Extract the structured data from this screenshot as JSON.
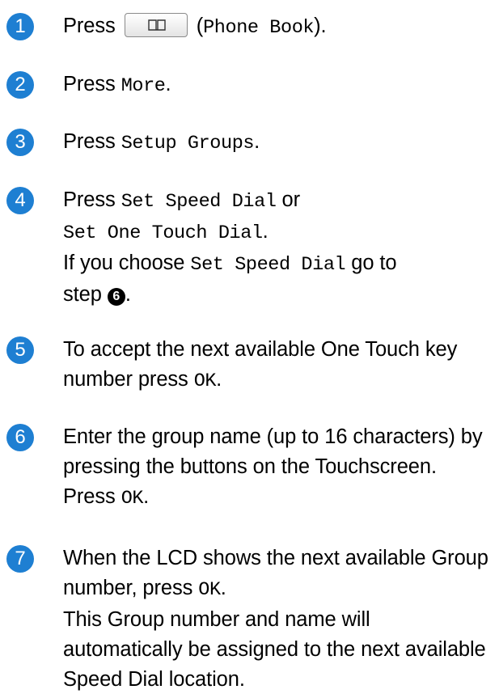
{
  "steps": [
    {
      "number": "1",
      "press": "Press",
      "paren_open": "(",
      "mono": "Phone Book",
      "paren_close": ").",
      "icon": "phone-book-icon"
    },
    {
      "number": "2",
      "press": "Press",
      "mono": "More",
      "end": "."
    },
    {
      "number": "3",
      "press": "Press",
      "mono": "Setup Groups",
      "end": "."
    },
    {
      "number": "4",
      "press": "Press",
      "mono_a": "Set Speed Dial",
      "or": "or",
      "mono_b": "Set One Touch Dial",
      "end_b": ".",
      "line3": "If you choose",
      "mono_c": "Set Speed Dial",
      "goto": "go to",
      "step_word": "step",
      "ref": "6",
      "end_c": "."
    },
    {
      "number": "5",
      "text": "To accept the next available One Touch key number press",
      "mono": "OK",
      "end": "."
    },
    {
      "number": "6",
      "text": "Enter the group name (up to 16 characters) by pressing the buttons on the Touchscreen.",
      "press": "Press",
      "mono": "OK",
      "end": "."
    },
    {
      "number": "7",
      "text": "When the LCD shows the next available Group number, press",
      "mono": "OK",
      "end": ".",
      "text2": "This Group number and name will automatically be assigned to the next available Speed Dial location."
    }
  ],
  "colors": {
    "step_circle": "#1e7fd2"
  }
}
